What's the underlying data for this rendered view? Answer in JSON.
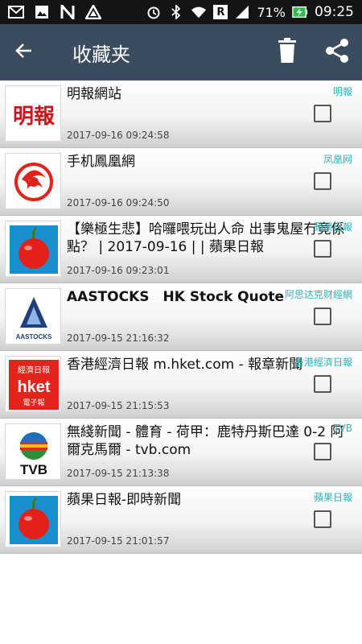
{
  "status": {
    "battery": "71%",
    "time": "09:25",
    "roaming": "R"
  },
  "appbar": {
    "title": "收藏夹"
  },
  "items": [
    {
      "title": "明報網站",
      "date": "2017-09-16 09:24:58",
      "source": "明報",
      "bold": false
    },
    {
      "title": "手机鳳凰網",
      "date": "2017-09-16 09:24:50",
      "source": "凤凰网",
      "bold": false
    },
    {
      "title": "【樂極生悲】哈囉喂玩出人命 出事鬼屋冇竟係點？ | 2017-09-16 | | 蘋果日報",
      "date": "2017-09-16 09:23:01",
      "source": "蘋果日報",
      "bold": false
    },
    {
      "title": "AASTOCKS　HK Stock Quote",
      "date": "2017-09-15 21:16:32",
      "source": "阿思达克财經網",
      "bold": true
    },
    {
      "title": "香港經濟日報 m.hket.com - 報章新聞",
      "date": "2017-09-15 21:15:53",
      "source": "香港經濟日報",
      "bold": false
    },
    {
      "title": "無綫新聞 - 體育 - 荷甲：鹿特丹斯巴達 0-2 阿爾克馬爾 - tvb.com",
      "date": "2017-09-15 21:13:38",
      "source": "TVB",
      "bold": false
    },
    {
      "title": "蘋果日報-即時新聞",
      "date": "2017-09-15 21:01:57",
      "source": "蘋果日報",
      "bold": false
    }
  ],
  "logos": {
    "mingpao": "明報",
    "hket_top": "經濟日報",
    "hket_main": "hket",
    "hket_sub": "電子報",
    "tvb": "TVB",
    "aastocks": "AASTOCKS"
  },
  "colors": {
    "appbar": "#3a4c5e",
    "source": "#2fb3b8",
    "statusbar": "#141414"
  }
}
